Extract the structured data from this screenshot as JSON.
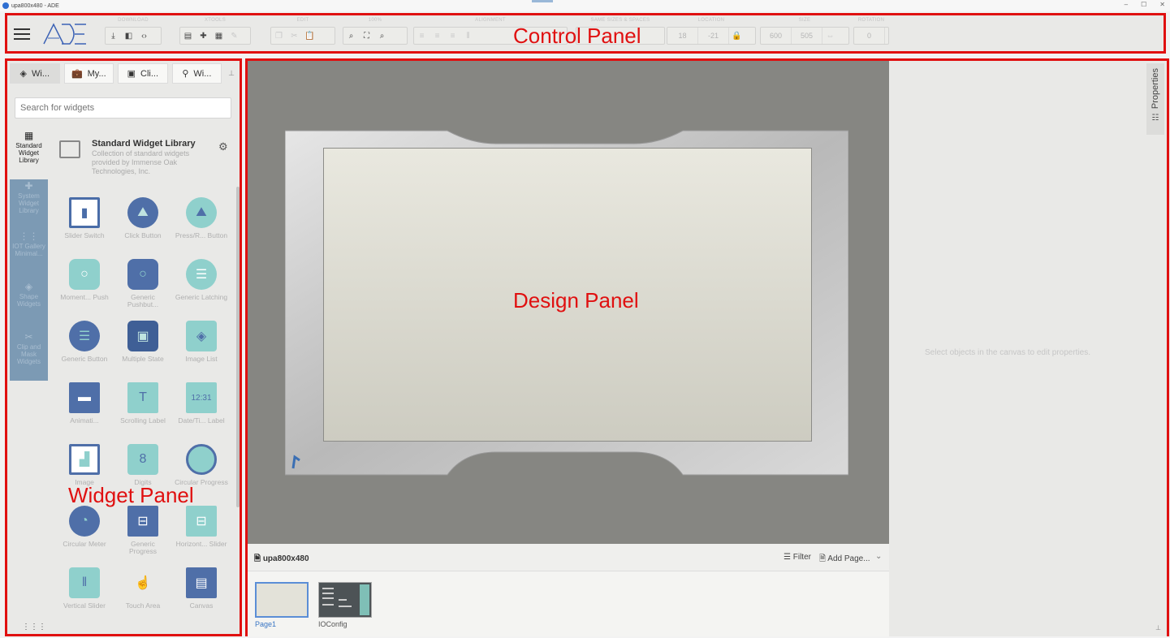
{
  "window": {
    "title": "upa800x480 - ADE",
    "min": "–",
    "max": "☐",
    "close": "✕"
  },
  "control_panel": {
    "annotation": "Control Panel",
    "groups": [
      {
        "label": "DOWNLOAD"
      },
      {
        "label": "XTOOLS"
      },
      {
        "label": "EDIT"
      },
      {
        "label": "100%"
      },
      {
        "label": "ALIGNMENT"
      },
      {
        "label": "SAME SIZES & SPACES"
      },
      {
        "label": "LOCATION"
      },
      {
        "label": "SIZE"
      },
      {
        "label": "ROTATION"
      }
    ],
    "location_x": "18",
    "location_y": "-21",
    "size_w": "600",
    "size_h": "505",
    "rotation": "0"
  },
  "widget_panel": {
    "annotation": "Widget Panel",
    "tabs": [
      "Wi...",
      "My...",
      "Cli...",
      "Wi..."
    ],
    "search_placeholder": "Search for widgets",
    "categories": [
      {
        "label": "Standard Widget Library"
      },
      {
        "label": "System Widget Library"
      },
      {
        "label": "IOT Gallery Minimal..."
      },
      {
        "label": "Shape Widgets"
      },
      {
        "label": "Clip and Mask Widgets"
      }
    ],
    "library": {
      "title": "Standard Widget Library",
      "description": "Collection of standard widgets provided by Immense Oak Technologies, Inc."
    },
    "widgets": [
      "Slider Switch",
      "Click Button",
      "Press/R... Button",
      "Moment... Push",
      "Generic Pushbut...",
      "Generic Latching",
      "Generic Button",
      "Multiple State",
      "Image List",
      "Animati...",
      "Scrolling Label",
      "Date/Ti... Label",
      "Image",
      "Digits",
      "Circular Progress",
      "Circular Meter",
      "Generic Progress",
      "Horizont... Slider",
      "Vertical Slider",
      "Touch Area",
      "Canvas"
    ]
  },
  "design_panel": {
    "annotation": "Design Panel",
    "page_bar": {
      "project": "upa800x480",
      "filter": "Filter",
      "add_page": "Add Page..."
    },
    "pages": [
      "Page1",
      "IOConfig"
    ]
  },
  "properties": {
    "tab": "Properties",
    "hint": "Select objects in the canvas to edit properties."
  }
}
